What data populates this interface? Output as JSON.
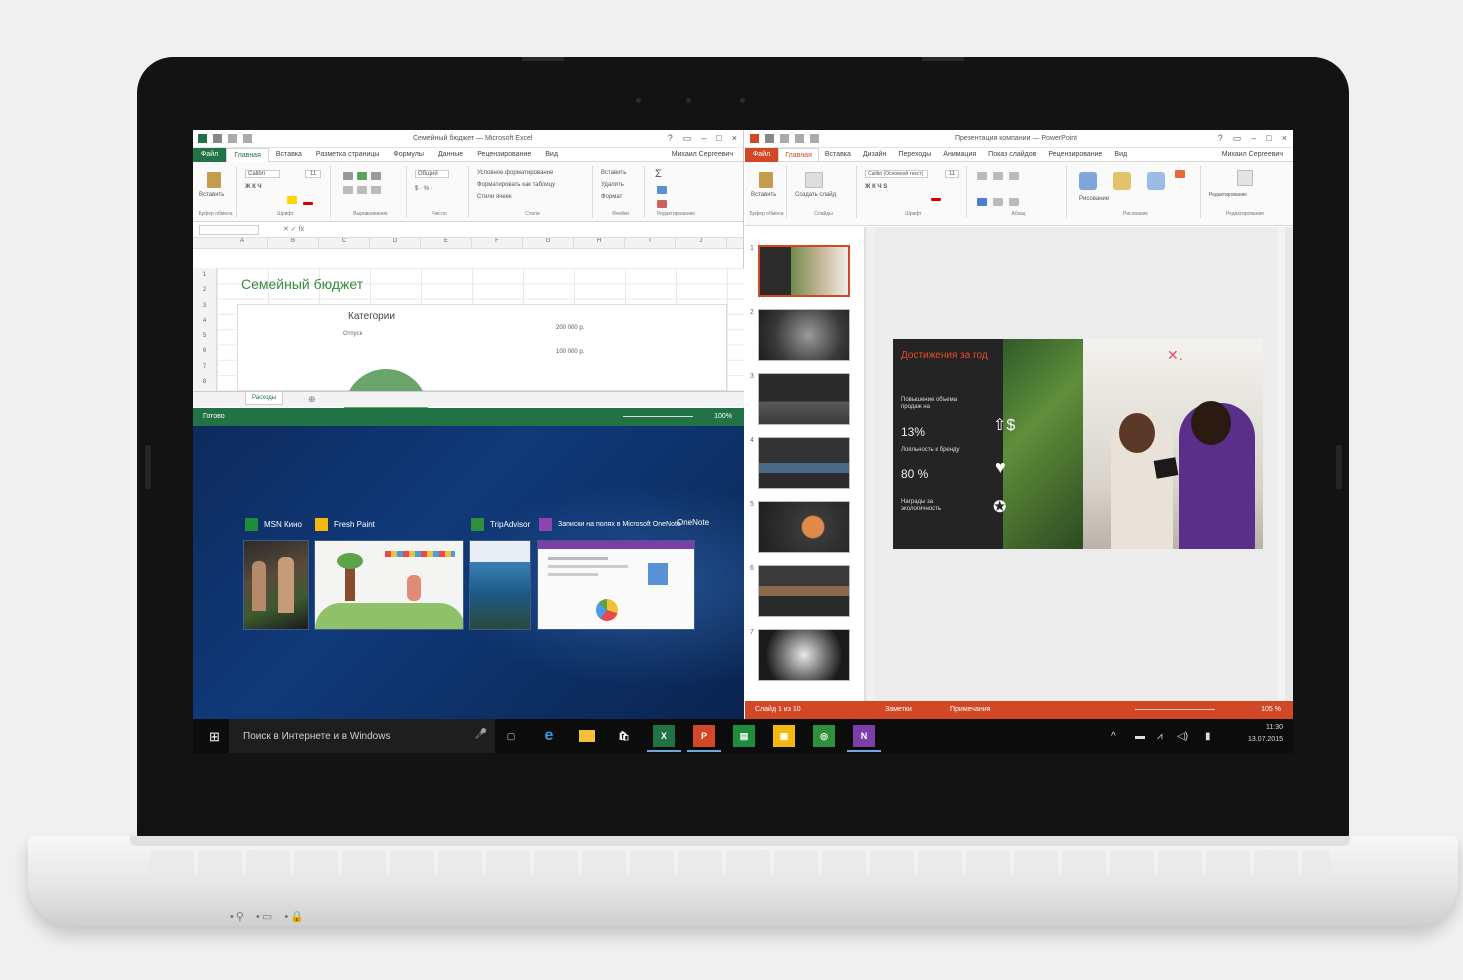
{
  "excel": {
    "title": "Семейный бюджет — Microsoft Excel",
    "tabs": [
      "Файл",
      "Главная",
      "Вставка",
      "Разметка страницы",
      "Формулы",
      "Данные",
      "Рецензирование",
      "Вид"
    ],
    "user": "Михаил Сергеевич",
    "ribbon": {
      "paste": "Вставить",
      "font": "Calibri",
      "size": "11",
      "format": "Общий",
      "cond_format": "Условное форматирование",
      "as_table": "Форматировать как таблицу",
      "cell_styles": "Стили ячеек",
      "insert": "Вставить",
      "delete": "Удалить",
      "cell_format": "Формат"
    },
    "ribbon_groups": [
      "Буфер обмена",
      "Шрифт",
      "Выравнивание",
      "Число",
      "Стили",
      "Ячейки",
      "Редактирование"
    ],
    "columns": [
      "A",
      "B",
      "C",
      "D",
      "E",
      "F",
      "G",
      "H",
      "I",
      "J"
    ],
    "rows": [
      "1",
      "2",
      "3",
      "4",
      "5",
      "6",
      "7",
      "8"
    ],
    "sheet_title": "Семейный бюджет",
    "chart_title": "Категории",
    "chart_legend": "Отпуск",
    "chart_value_1": "200 000 р.",
    "chart_value_2": "100 000 р.",
    "sheet_tab": "Расходы",
    "status": "Готово",
    "zoom": "100%"
  },
  "taskview": {
    "apps": [
      {
        "label": "MSN Кино",
        "color": "#1e8c3a"
      },
      {
        "label": "Fresh Paint",
        "color": "#f3b90f"
      },
      {
        "label": "TripAdvisor",
        "color": "#2f8f3a"
      },
      {
        "label": "Записки на полях в Microsoft OneNote",
        "color": "#8e44ad"
      },
      {
        "label": "OneNote",
        "color": "#7a3fa8"
      }
    ]
  },
  "ppt": {
    "title": "Презентация компании — PowerPoint",
    "tabs": [
      "Файл",
      "Главная",
      "Вставка",
      "Дизайн",
      "Переходы",
      "Анимация",
      "Показ слайдов",
      "Рецензирование",
      "Вид"
    ],
    "user": "Михаил Сергеевич",
    "ribbon": {
      "paste": "Вставить",
      "new_slide": "Создать слайд",
      "font": "Calibri (Основной текст)",
      "size": "11",
      "drawing": "Рисование",
      "editing": "Редактирование"
    },
    "ribbon_groups": [
      "Буфер обмена",
      "Слайды",
      "Шрифт",
      "Абзац",
      "Рисование",
      "Редактирование"
    ],
    "slide_numbers": [
      "1",
      "2",
      "3",
      "4",
      "5",
      "6",
      "7"
    ],
    "slide": {
      "heading": "Достижения за год",
      "item1": "Повышение объема продаж на",
      "item1_value": "13%",
      "item2": "Лояльность к бренду",
      "item2_value": "80 %",
      "item3": "Награды за экологичность"
    },
    "status": {
      "slide_count": "Слайд 1 из 10",
      "notes": "Заметки",
      "comments": "Примечания",
      "zoom": "105 %"
    }
  },
  "taskbar": {
    "search": "Поиск в Интернете и в Windows",
    "time": "11:30",
    "date": "13.07.2015"
  }
}
